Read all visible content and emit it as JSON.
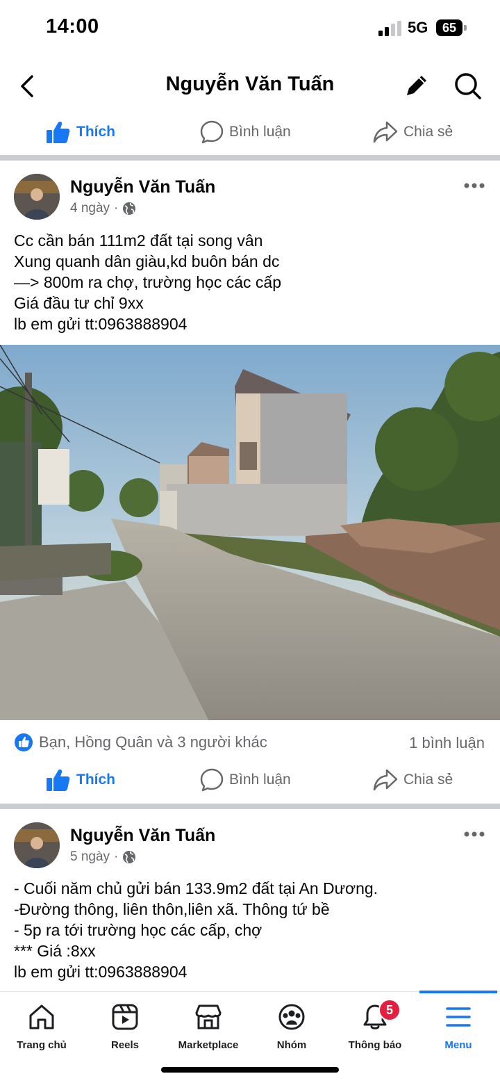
{
  "status_bar": {
    "time": "14:00",
    "network": "5G",
    "battery": "65"
  },
  "header": {
    "title": "Nguyễn Văn Tuấn"
  },
  "actions": {
    "like": "Thích",
    "comment": "Bình luận",
    "share": "Chia sẻ"
  },
  "posts": [
    {
      "author": "Nguyễn Văn Tuấn",
      "time": "4 ngày",
      "text": "Cc cần bán 111m2 đất tại song vân\nXung quanh dân giàu,kd buôn bán dc\n—> 800m ra chợ, trường học các cấp\nGiá đầu tư chỉ 9xx\nlb em gửi tt:0963888904",
      "reactions": "Bạn, Hồng Quân và 3 người khác",
      "comments": "1 bình luận"
    },
    {
      "author": "Nguyễn Văn Tuấn",
      "time": "5 ngày",
      "text": "- Cuối năm chủ gửi bán 133.9m2 đất tại An Dương.\n-Đường thông, liên thôn,liên xã. Thông tứ bề\n- 5p ra tới trường học các cấp, chợ\n*** Giá :8xx\nlb em gửi tt:0963888904"
    }
  ],
  "bottom_nav": {
    "items": [
      {
        "label": "Trang chủ",
        "icon": "home-icon"
      },
      {
        "label": "Reels",
        "icon": "reels-icon"
      },
      {
        "label": "Marketplace",
        "icon": "marketplace-icon"
      },
      {
        "label": "Nhóm",
        "icon": "groups-icon"
      },
      {
        "label": "Thông báo",
        "icon": "bell-icon",
        "badge": "5"
      },
      {
        "label": "Menu",
        "icon": "menu-icon"
      }
    ],
    "active": "Menu"
  },
  "colors": {
    "accent": "#1877f2",
    "text": "#050505",
    "secondary": "#65676b",
    "badge": "#e41e3f"
  }
}
